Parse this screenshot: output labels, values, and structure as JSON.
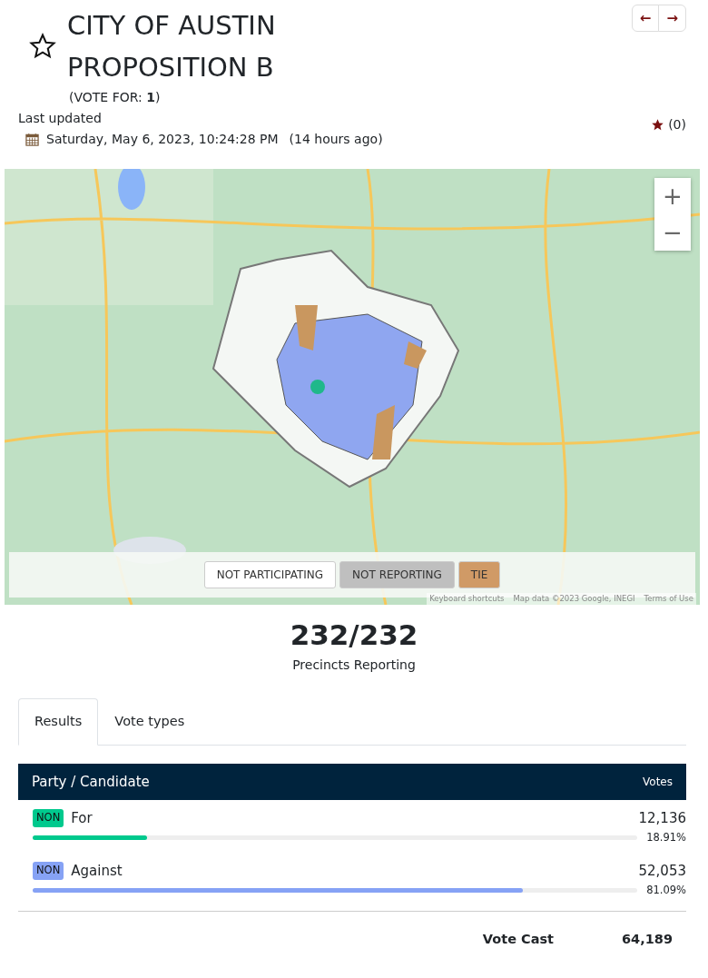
{
  "title_lines": [
    "CITY OF AUSTIN",
    "PROPOSITION B"
  ],
  "vote_for": "(VOTE FOR: **1**)",
  "favorite": {
    "starred": false
  },
  "nav": {
    "prev": "←",
    "next": "→"
  },
  "last_updated": {
    "label": "Last updated",
    "date": "Saturday, May 6, 2023, 10:24:28 PM",
    "ago": "(14 hours ago)"
  },
  "favorites_count": "(0)",
  "map": {
    "zoom_in": "+",
    "zoom_out": "−",
    "legend": [
      {
        "label": "NOT PARTICIPATING",
        "color": "#ffffff"
      },
      {
        "label": "NOT REPORTING",
        "color": "#bfbfbf"
      },
      {
        "label": "TIE",
        "color": "#d09a66"
      }
    ],
    "attribution": [
      "Keyboard shortcuts",
      "Map data ©2023 Google, INEGI",
      "Terms of Use"
    ]
  },
  "precincts": {
    "count": "232/232",
    "label": "Precincts Reporting"
  },
  "tabs": [
    {
      "label": "Results",
      "selected": true
    },
    {
      "label": "Vote types",
      "selected": false
    }
  ],
  "table": {
    "columns": [
      "Party / Candidate",
      "Votes"
    ],
    "rows": [
      {
        "party": "NON",
        "name": "For",
        "votes": "12,136",
        "percent": "18.91%",
        "level": 0.1891,
        "color": "#00c98d"
      },
      {
        "party": "NON",
        "name": "Against",
        "votes": "52,053",
        "percent": "81.09%",
        "level": 0.8109,
        "color": "#86a2f5"
      }
    ],
    "total_label": "Vote Cast",
    "total": "64,189"
  }
}
